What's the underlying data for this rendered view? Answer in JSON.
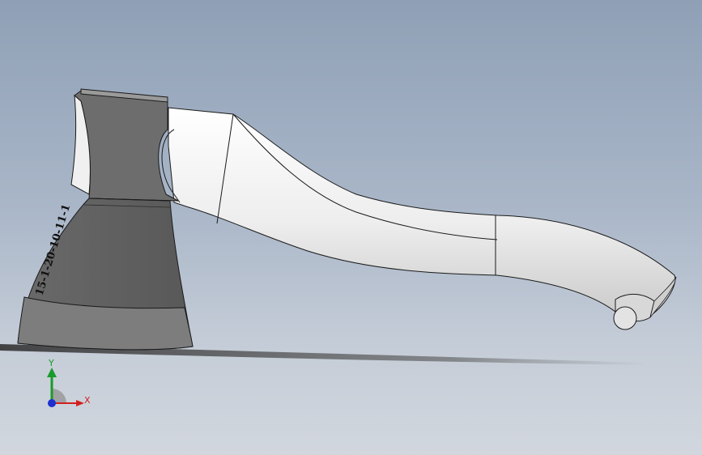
{
  "viewport": {
    "model_name": "axe",
    "engraving_text": "15-1-20-10-11-1",
    "colors": {
      "background_top": "#8fa0b6",
      "background_bottom": "#d2d7de",
      "blade_dark": "#5c5c5c",
      "blade_light": "#777777",
      "handle": "#f2f2f2",
      "edge_lines": "#1a1a1a"
    }
  },
  "triad": {
    "x_label": "X",
    "y_label": "Y",
    "x_color": "#d22020",
    "y_color": "#1a9a2a",
    "z_color": "#1d2fd0"
  }
}
